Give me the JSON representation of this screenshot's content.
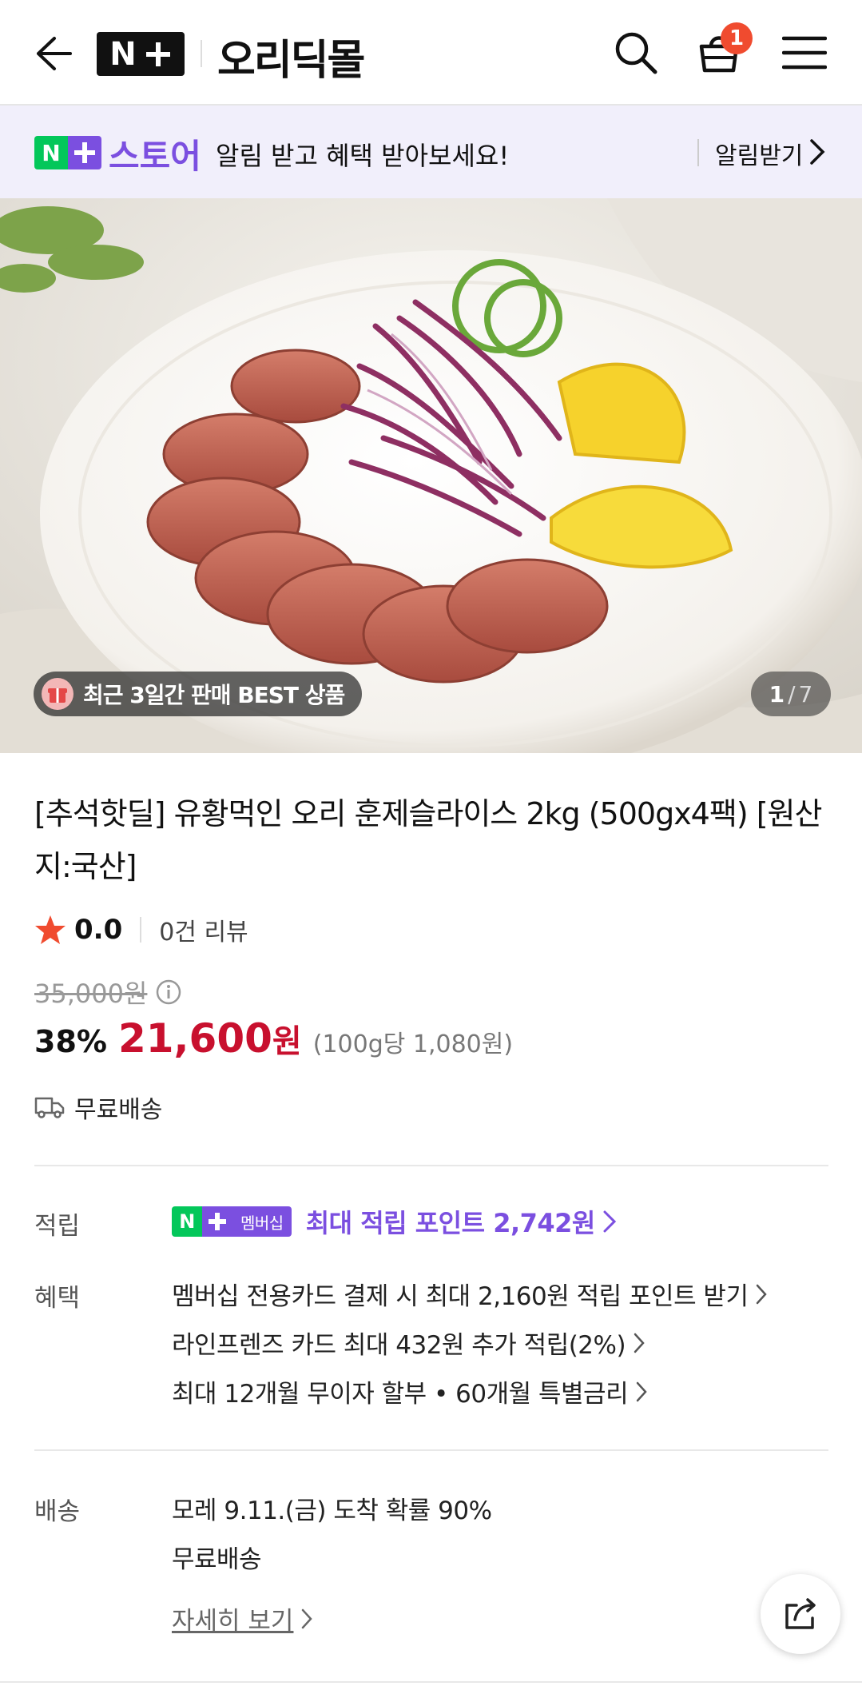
{
  "header": {
    "brand_logo": "N+",
    "mall_name": "오리딕몰",
    "cart_count": "1",
    "icons": [
      "back-arrow-icon",
      "search-icon",
      "cart-icon",
      "menu-icon"
    ]
  },
  "store_banner": {
    "logo": "N",
    "store_label": "스토어",
    "message": "알림 받고 혜택 받아보세요!",
    "cta": "알림받기"
  },
  "hero": {
    "badge_text": "최근 3일간 판매 BEST 상품",
    "current_index": "1",
    "separator": "/",
    "total": "7"
  },
  "product": {
    "title": "[추석핫딜] 유황먹인 오리 훈제슬라이스 2kg (500gx4팩) [원산지:국산]",
    "rating": "0.0",
    "review_count": "0건 리뷰",
    "original_price": "35,000원",
    "discount": "38%",
    "price": "21,600",
    "price_unit": "원",
    "unit_price": "(100g당 1,080원)",
    "shipping_badge": "무료배송"
  },
  "benefits": {
    "points_label": "적립",
    "membership_badge_n": "N",
    "membership_badge_text": "멤버십",
    "points_text": "최대 적립 포인트 2,742원",
    "benefit_label": "혜택",
    "benefit_lines": [
      "멤버십 전용카드 결제 시 최대 2,160원 적립 포인트 받기",
      "라인프렌즈 카드 최대 432원 추가 적립(2%)",
      "최대 12개월 무이자 할부 • 60개월 특별금리"
    ]
  },
  "delivery": {
    "label": "배송",
    "arrival": "모레 9.11.(금) 도착 확률 90%",
    "fee": "무료배송",
    "detail_link": "자세히 보기"
  },
  "colors": {
    "accent_purple": "#7b4fe0",
    "naver_green": "#03c75a",
    "price_red": "#c8102e",
    "badge_orange": "#f04b2f"
  }
}
